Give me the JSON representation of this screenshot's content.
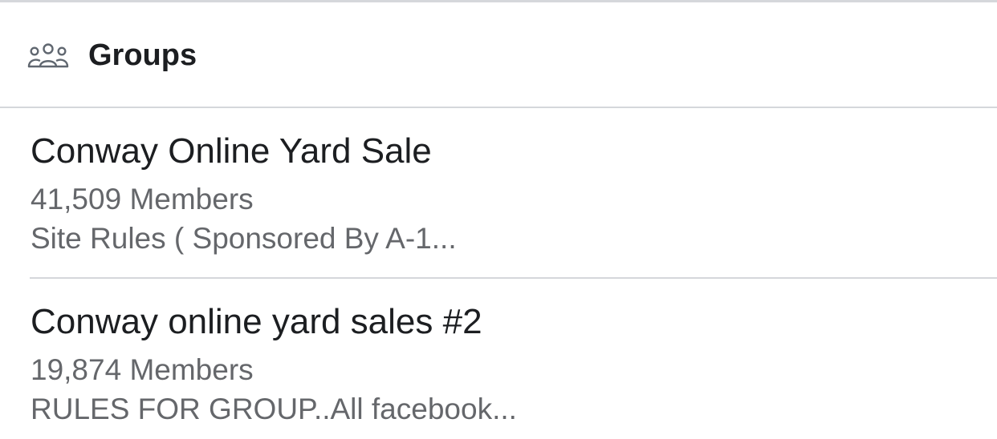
{
  "section": {
    "title": "Groups",
    "icon": "groups-icon"
  },
  "groups": [
    {
      "name": "Conway Online Yard Sale",
      "members": "41,509 Members",
      "description": "Site Rules ( Sponsored By A-1..."
    },
    {
      "name": "Conway online yard sales #2",
      "members": "19,874 Members",
      "description": "RULES FOR GROUP..All facebook..."
    }
  ],
  "colors": {
    "primary_text": "#1c1e21",
    "secondary_text": "#65676b",
    "divider": "#d5d7db",
    "icon": "#606770"
  }
}
